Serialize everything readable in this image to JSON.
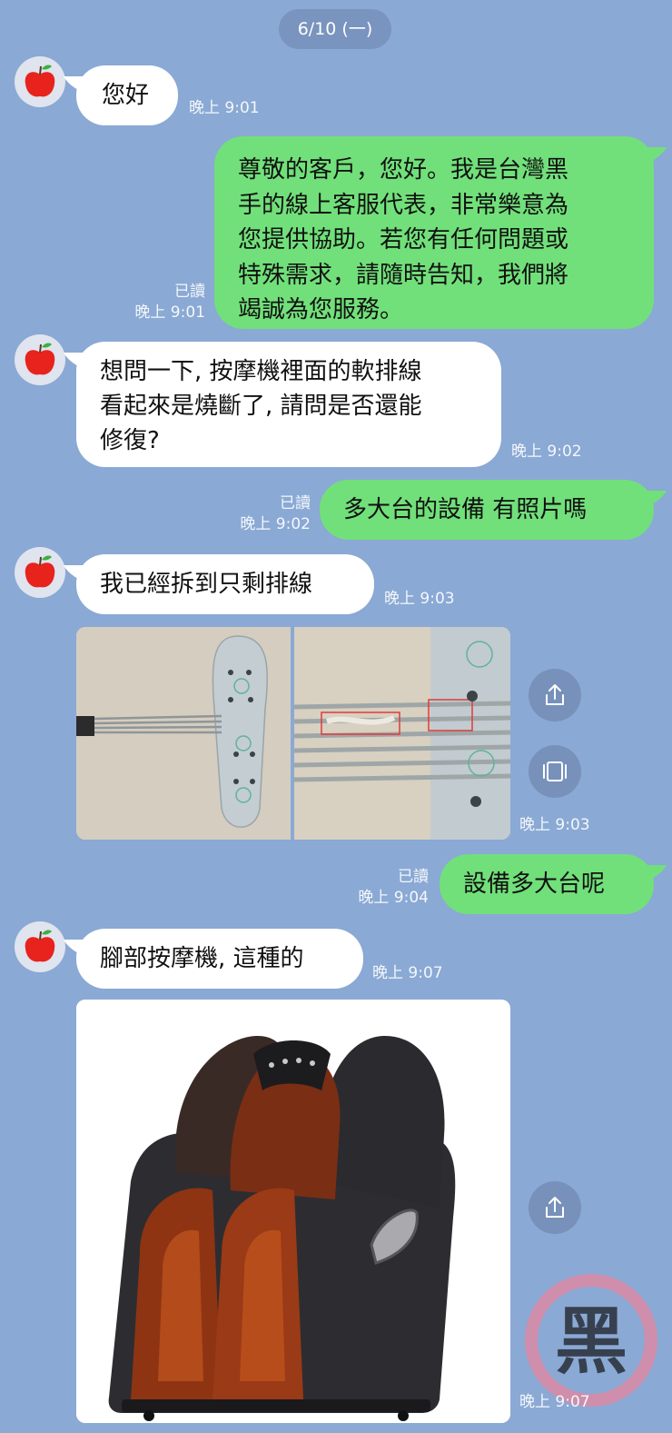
{
  "date_separator": "6/10 (一)",
  "messages": [
    {
      "text": "您好",
      "time": "晚上 9:01"
    },
    {
      "lines": [
        "尊敬的客戶，您好。我是台灣黑",
        "手的線上客服代表，非常樂意為",
        "您提供協助。若您有任何問題或",
        "特殊需求，請隨時告知，我們將",
        "竭誠為您服務。"
      ],
      "read": "已讀",
      "time": "晚上 9:01"
    },
    {
      "lines": [
        "想問一下, 按摩機裡面的軟排線",
        "看起來是燒斷了, 請問是否還能",
        "修復?"
      ],
      "time": "晚上 9:02"
    },
    {
      "text": "多大台的設備 有照片嗎",
      "read": "已讀",
      "time": "晚上 9:02"
    },
    {
      "text": "我已經拆到只剩排線",
      "time": "晚上 9:03"
    },
    {
      "photo_time": "晚上 9:03"
    },
    {
      "text": "設備多大台呢",
      "read": "已讀",
      "time": "晚上 9:04"
    },
    {
      "text": "腳部按摩機, 這種的",
      "time": "晚上 9:07"
    },
    {
      "photo_time": "晚上 9:07"
    }
  ],
  "icons": {
    "avatar": "apple-icon",
    "share": "share-icon",
    "carousel": "carousel-icon"
  },
  "watermark_text": "黑",
  "colors": {
    "background": "#8aa9d4",
    "incoming_bubble": "#ffffff",
    "outgoing_bubble": "#71e07a",
    "date_pill": "#7994bf"
  }
}
